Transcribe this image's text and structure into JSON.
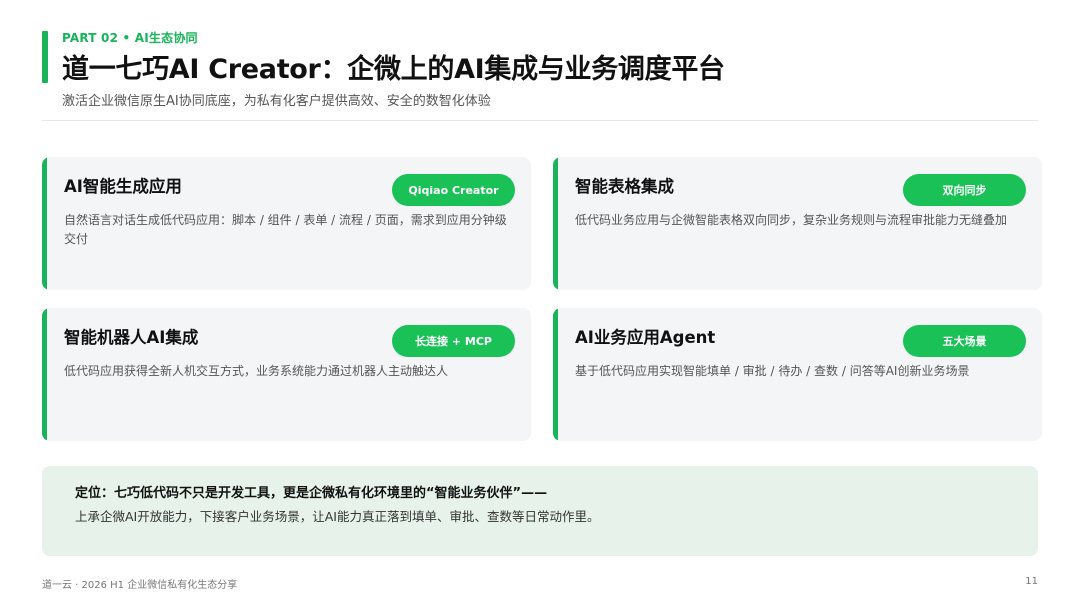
{
  "header": {
    "kicker": "PART 02 • AI生态协同",
    "title": "道一七巧AI Creator：企微上的AI集成与业务调度平台",
    "subtitle": "激活企业微信原生AI协同底座，为私有化客户提供高效、安全的数智化体验"
  },
  "cards": [
    {
      "title": "AI智能生成应用",
      "badge": "Qiqiao Creator",
      "desc": "自然语言对话生成低代码应用：脚本 / 组件 / 表单 / 流程 / 页面，需求到应用分钟级交付"
    },
    {
      "title": "智能表格集成",
      "badge": "双向同步",
      "desc": "低代码业务应用与企微智能表格双向同步，复杂业务规则与流程审批能力无缝叠加"
    },
    {
      "title": "智能机器人AI集成",
      "badge": "长连接 + MCP",
      "desc": "低代码应用获得全新人机交互方式，业务系统能力通过机器人主动触达人"
    },
    {
      "title": "AI业务应用Agent",
      "badge": "五大场景",
      "desc": "基于低代码应用实现智能填单 / 审批 / 待办 / 查数 / 问答等AI创新业务场景"
    }
  ],
  "positioning": {
    "title": "定位：七巧低代码不只是开发工具，更是企微私有化环境里的“智能业务伙伴”——",
    "body": "上承企微AI开放能力，下接客户业务场景，让AI能力真正落到填单、审批、查数等日常动作里。"
  },
  "footer": {
    "left": "道一云 · 2026 H1 企业微信私有化生态分享",
    "page_number": "11"
  },
  "colors": {
    "accent": "#18b35a",
    "badge": "#19c157",
    "card_bg": "#f4f5f7",
    "positioning_bg": "#e7f3ea"
  }
}
